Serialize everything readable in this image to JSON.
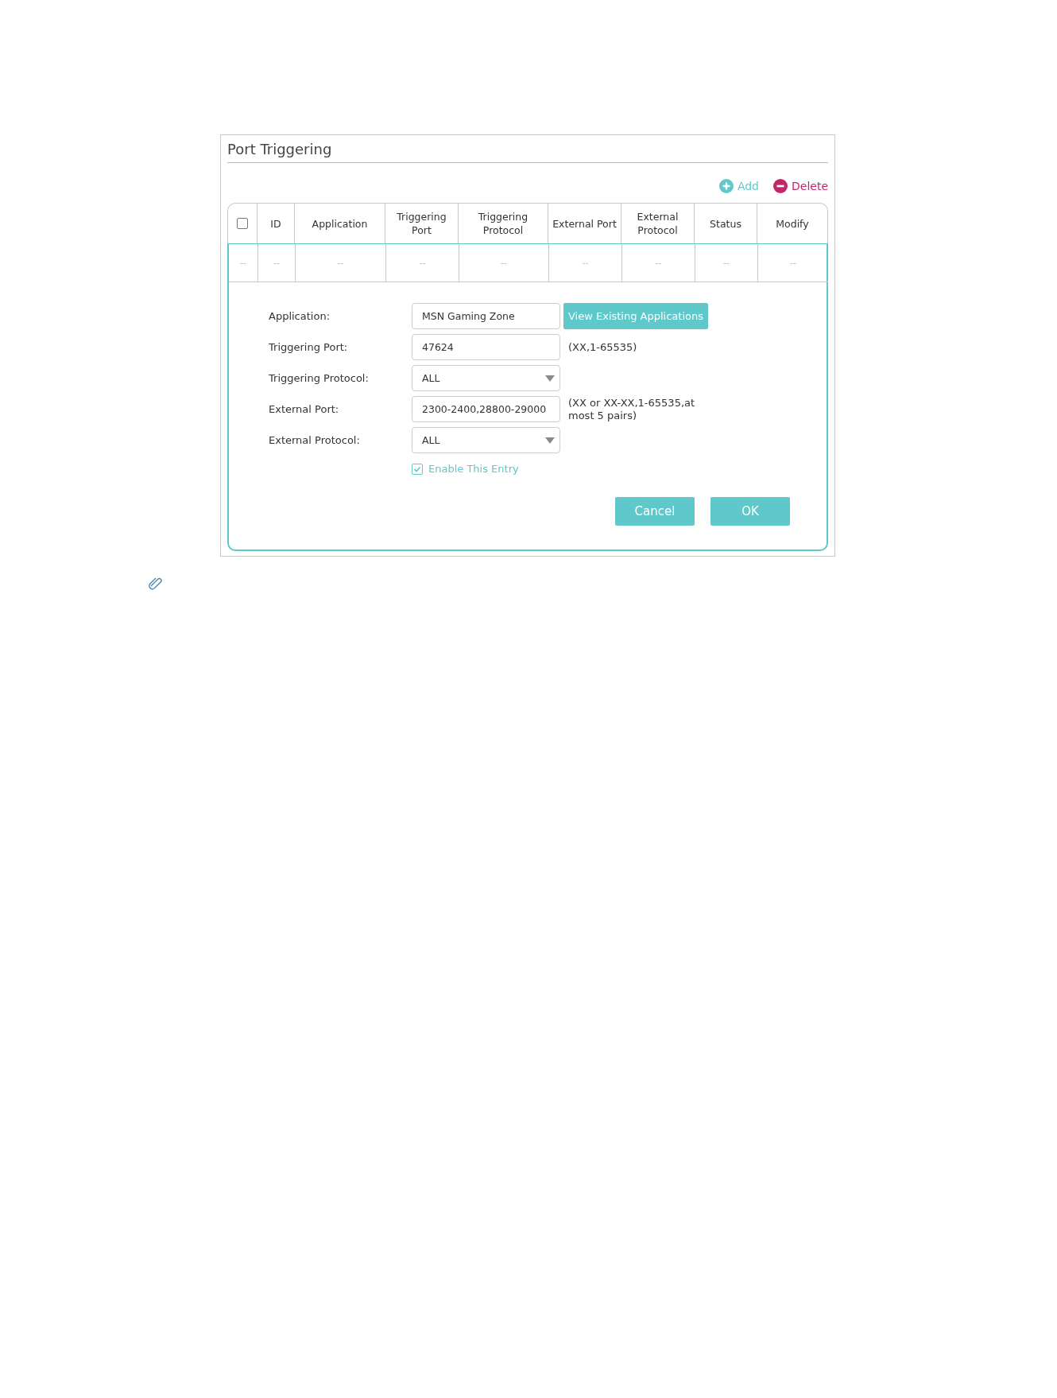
{
  "title": "Port Triggering",
  "toolbar": [
    {
      "kind": "add",
      "label": "Add"
    },
    {
      "kind": "delete",
      "label": "Delete"
    }
  ],
  "table": {
    "columns": [
      {
        "kind": "checkbox",
        "checked": false
      },
      {
        "kind": "text",
        "label": "ID"
      },
      {
        "kind": "text",
        "label": "Application"
      },
      {
        "kind": "text",
        "label": "Triggering Port"
      },
      {
        "kind": "text",
        "label": "Triggering Protocol"
      },
      {
        "kind": "text",
        "label": "External Port"
      },
      {
        "kind": "text",
        "label": "External Protocol"
      },
      {
        "kind": "text",
        "label": "Status"
      },
      {
        "kind": "text",
        "label": "Modify"
      }
    ],
    "rows": [
      [
        "--",
        "--",
        "--",
        "--",
        "--",
        "--",
        "--",
        "--",
        "--"
      ]
    ]
  },
  "form": {
    "fields": [
      {
        "kind": "text",
        "label": "Application:",
        "value": "MSN Gaming Zone",
        "button": "View Existing Applications"
      },
      {
        "kind": "text",
        "label": "Triggering Port:",
        "value": "47624",
        "hint": "(XX,1-65535)"
      },
      {
        "kind": "select",
        "label": "Triggering Protocol:",
        "value": "ALL"
      },
      {
        "kind": "text",
        "label": "External Port:",
        "value": "2300-2400,28800-29000",
        "hint": "(XX or XX-XX,1-65535,at most 5 pairs)"
      },
      {
        "kind": "select",
        "label": "External Protocol:",
        "value": "ALL"
      }
    ],
    "enable": {
      "label": "Enable This Entry",
      "checked": true
    },
    "buttons": [
      "Cancel",
      "OK"
    ]
  }
}
